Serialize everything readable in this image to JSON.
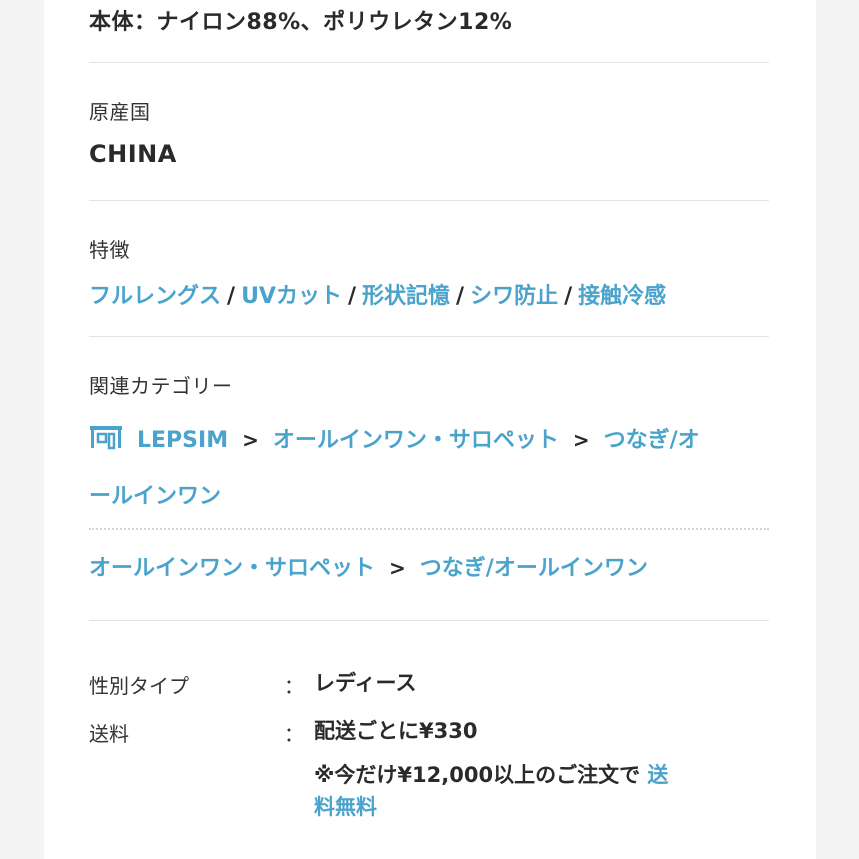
{
  "material": {
    "text": "本体：ナイロン88%、ポリウレタン12%"
  },
  "origin": {
    "heading": "原産国",
    "value": "CHINA"
  },
  "features": {
    "heading": "特徴",
    "items": [
      "フルレングス",
      "UVカット",
      "形状記憶",
      "シワ防止",
      "接触冷感"
    ],
    "separator": "/"
  },
  "categories": {
    "heading": "関連カテゴリー",
    "shop_icon": "shop-icon",
    "path1": {
      "shop": "LEPSIM",
      "cat": "オールインワン・サロペット",
      "sub_line1": "つなぎ/オ",
      "sub_line2": "ールインワン"
    },
    "path2": {
      "cat": "オールインワン・サロペット",
      "sub": "つなぎ/オールインワン"
    },
    "arrow": ">"
  },
  "details": {
    "gender_label": "性別タイプ",
    "gender_value": "レディース",
    "shipping_label": "送料",
    "shipping_value": "配送ごとに¥330",
    "note_text": "※今だけ¥12,000以上のご注文で",
    "note_link_1": "送",
    "note_link_2": "料無料",
    "colon": "："
  },
  "colors": {
    "link": "#4aa3cc",
    "text": "#2a2a2a",
    "background": "#f4f4f5"
  }
}
